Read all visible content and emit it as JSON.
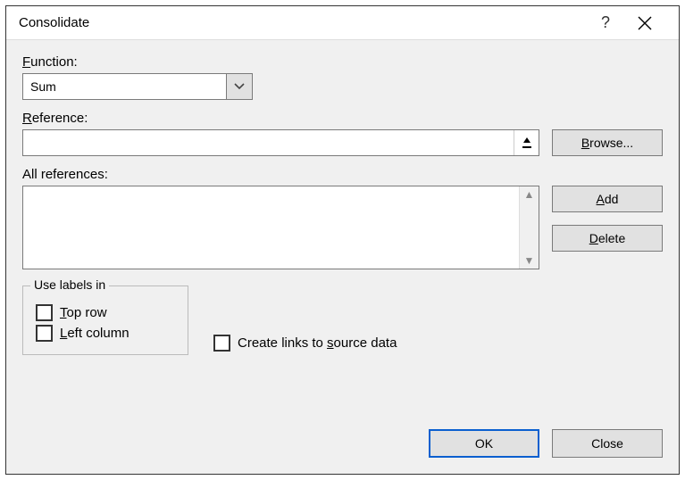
{
  "title": "Consolidate",
  "labels": {
    "function": "Function:",
    "reference": "Reference:",
    "all_references": "All references:",
    "use_labels_in": "Use labels in",
    "top_row": "Top row",
    "left_column": "Left column",
    "create_links": "Create links to source data"
  },
  "function": {
    "selected": "Sum"
  },
  "reference": {
    "value": ""
  },
  "buttons": {
    "browse": "Browse...",
    "add": "Add",
    "delete": "Delete",
    "ok": "OK",
    "close": "Close"
  },
  "checkboxes": {
    "top_row": false,
    "left_column": false,
    "create_links": false
  }
}
